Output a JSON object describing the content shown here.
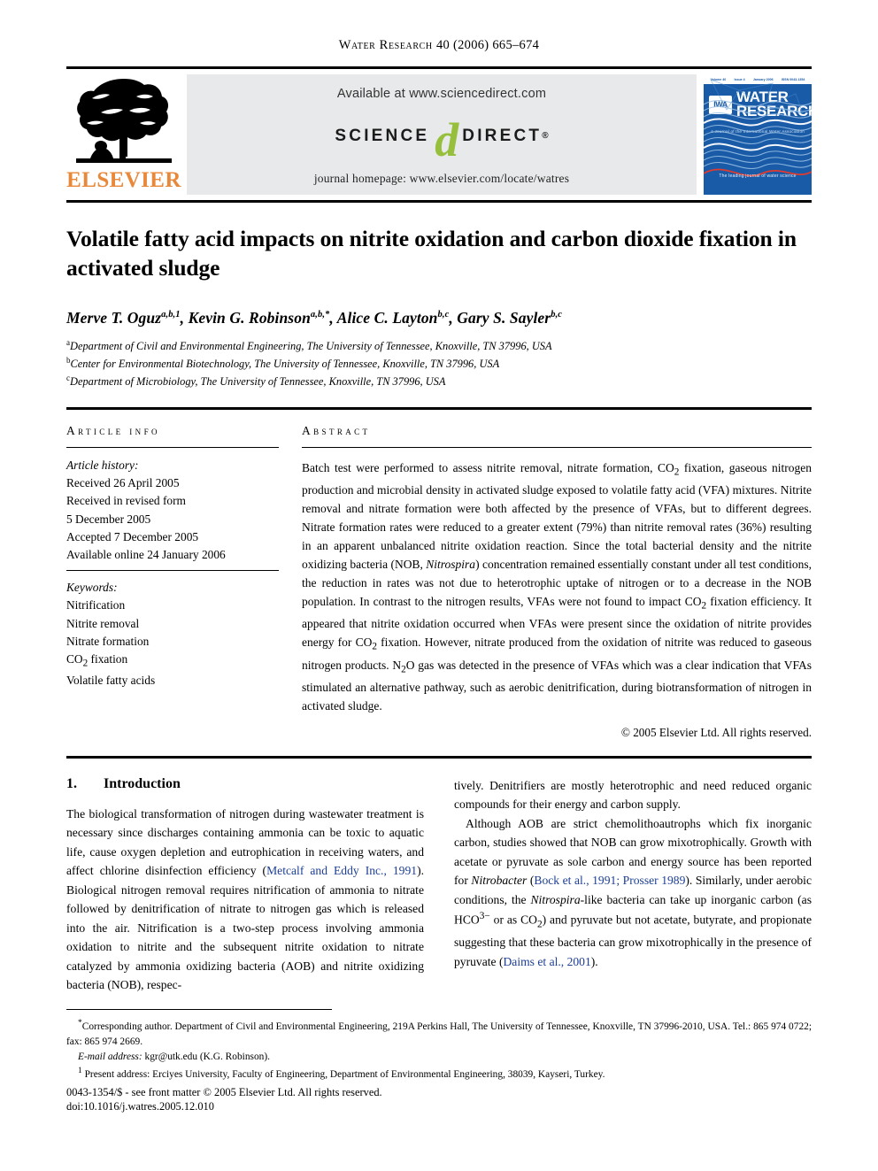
{
  "running_head": {
    "journal": "Water Research",
    "volume_line": "40 (2006) 665–674"
  },
  "masthead": {
    "publisher_logo_name": "elsevier-tree-logo",
    "publisher_wordmark": "ELSEVIER",
    "sciencedirect": {
      "available_at": "Available at www.sciencedirect.com",
      "logo_left": "SCIENCE",
      "logo_mark": "d",
      "logo_right": "DIRECT",
      "registered_mark": "®",
      "journal_homepage": "journal homepage: www.elsevier.com/locate/watres"
    },
    "cover": {
      "strip_items": [
        "Volume 40",
        "Issue 4",
        "January 2006",
        "ISSN 0043-1354"
      ],
      "society_badge": "IWA",
      "title_line1": "WATER",
      "title_line2": "RESEARCH",
      "subtitle": "A Journal of the International Water Association",
      "tagline": "The leading journal of water science"
    }
  },
  "article": {
    "title": "Volatile fatty acid impacts on nitrite oxidation and carbon dioxide fixation in activated sludge",
    "authors": [
      {
        "name": "Merve T. Oguz",
        "sup": "a,b,1",
        "sep": ", "
      },
      {
        "name": "Kevin G. Robinson",
        "sup": "a,b,*",
        "sep": ", "
      },
      {
        "name": "Alice C. Layton",
        "sup": "b,c",
        "sep": ", "
      },
      {
        "name": "Gary S. Sayler",
        "sup": "b,c",
        "sep": ""
      }
    ],
    "affiliations": [
      {
        "mark": "a",
        "text": "Department of Civil and Environmental Engineering, The University of Tennessee, Knoxville, TN 37996, USA"
      },
      {
        "mark": "b",
        "text": "Center for Environmental Biotechnology, The University of Tennessee, Knoxville, TN 37996, USA"
      },
      {
        "mark": "c",
        "text": "Department of Microbiology, The University of Tennessee, Knoxville, TN 37996, USA"
      }
    ]
  },
  "article_info": {
    "heading": "Article info",
    "history_label": "Article history:",
    "history": [
      "Received 26 April 2005",
      "Received in revised form",
      "5 December 2005",
      "Accepted 7 December 2005",
      "Available online 24 January 2006"
    ],
    "keywords_label": "Keywords:",
    "keywords": [
      "Nitrification",
      "Nitrite removal",
      "Nitrate formation",
      "CO2 fixation",
      "Volatile fatty acids"
    ]
  },
  "abstract": {
    "heading": "Abstract",
    "part1": "Batch test were performed to assess nitrite removal, nitrate formation, CO",
    "sub1": "2",
    "part2": " fixation, gaseous nitrogen production and microbial density in activated sludge exposed to volatile fatty acid (VFA) mixtures. Nitrite removal and nitrate formation were both affected by the presence of VFAs, but to different degrees. Nitrate formation rates were reduced to a greater extent (79%) than nitrite removal rates (36%) resulting in an apparent unbalanced nitrite oxidation reaction. Since the total bacterial density and the nitrite oxidizing bacteria (NOB, ",
    "italic1": "Nitrospira",
    "part3": ") concentration remained essentially constant under all test conditions, the reduction in rates was not due to heterotrophic uptake of nitrogen or to a decrease in the NOB population. In contrast to the nitrogen results, VFAs were not found to impact CO",
    "sub2": "2",
    "part4": " fixation efficiency. It appeared that nitrite oxidation occurred when VFAs were present since the oxidation of nitrite provides energy for CO",
    "sub3": "2",
    "part5": " fixation. However, nitrate produced from the oxidation of nitrite was reduced to gaseous nitrogen products. N",
    "sub4": "2",
    "part6": "O gas was detected in the presence of VFAs which was a clear indication that VFAs stimulated an alternative pathway, such as aerobic denitrification, during biotransformation of nitrogen in activated sludge.",
    "copyright": "© 2005 Elsevier Ltd. All rights reserved."
  },
  "introduction": {
    "number": "1.",
    "heading": "Introduction",
    "left_p1_a": "The biological transformation of nitrogen during wastewater treatment is necessary since discharges containing ammonia can be toxic to aquatic life, cause oxygen depletion and eutrophication in receiving waters, and affect chlorine disinfection efficiency (",
    "left_cite1": "Metcalf and Eddy Inc., 1991",
    "left_p1_b": "). Biological nitrogen removal requires nitrification of ammonia to nitrate followed by denitrification of nitrate to nitrogen gas which is released into the air. Nitrification is a two-step process involving ammonia oxidation to nitrite and the subsequent nitrite oxidation to nitrate catalyzed by ammonia oxidizing bacteria (AOB) and nitrite oxidizing bacteria (NOB), respec-",
    "right_p1": "tively. Denitrifiers are mostly heterotrophic and need reduced organic compounds for their energy and carbon supply.",
    "right_p2_a": "Although AOB are strict chemolithoautrophs which fix inorganic carbon, studies showed that NOB can grow mixotrophically. Growth with acetate or pyruvate as sole carbon and energy source has been reported for ",
    "right_italic1": "Nitrobacter",
    "right_p2_b": " (",
    "right_cite1": "Bock et al., 1991; Prosser 1989",
    "right_p2_c": "). Similarly, under aerobic conditions, the ",
    "right_italic2": "Nitrospira",
    "right_p2_d": "-like bacteria can take up inorganic carbon (as HCO",
    "right_sup1": "3−",
    "right_p2_e": " or as CO",
    "right_sub1": "2",
    "right_p2_f": ") and pyruvate but not acetate, butyrate, and propionate suggesting that these bacteria can grow mixotrophically in the presence of pyruvate (",
    "right_cite2": "Daims et al., 2001",
    "right_p2_g": ")."
  },
  "footnotes": {
    "corresponding_mark": "*",
    "corresponding": "Corresponding author. Department of Civil and Environmental Engineering, 219A Perkins Hall, The University of Tennessee, Knoxville, TN 37996-2010, USA. Tel.: 865 974 0722; fax: 865 974 2669.",
    "email_label": "E-mail address:",
    "email_value": " kgr@utk.edu (K.G. Robinson).",
    "present_mark": "1",
    "present_address": " Present address: Erciyes University, Faculty of Engineering, Department of Environmental Engineering, 38039, Kayseri, Turkey.",
    "imprint": "0043-1354/$ - see front matter © 2005 Elsevier Ltd. All rights reserved.",
    "doi": "doi:10.1016/j.watres.2005.12.010"
  },
  "colors": {
    "elsevier_orange": "#e8883a",
    "sciencedirect_green": "#96c03c",
    "cover_blue": "#1a5ba8",
    "citation_blue": "#1c3f94",
    "banner_gray": "#e8e9ea"
  }
}
